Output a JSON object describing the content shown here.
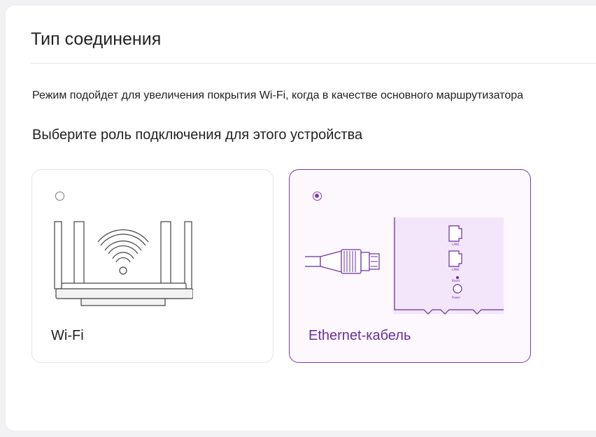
{
  "page": {
    "title": "Тип соединения",
    "description": "Режим подойдет для увеличения покрытия Wi-Fi, когда в качестве основного маршрутизатора",
    "subtitle": "Выберите роль подключения для этого устройства"
  },
  "options": [
    {
      "label": "Wi-Fi",
      "selected": false,
      "icon": "wifi-router-icon"
    },
    {
      "label": "Ethernet-кабель",
      "selected": true,
      "icon": "ethernet-cable-icon"
    }
  ],
  "illustration_text": {
    "port1": "LAN1",
    "port2": "LAN2",
    "reset": "Reset",
    "power": "Power"
  },
  "colors": {
    "accent": "#7c3aad",
    "accent_light": "#f3e6fb",
    "text": "#222222",
    "border": "#e4e4e8"
  }
}
